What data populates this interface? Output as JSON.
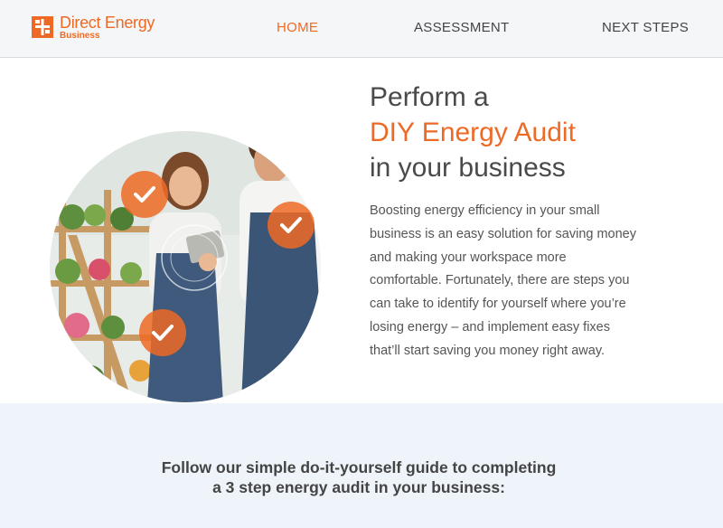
{
  "header": {
    "logo": {
      "name": "Direct Energy",
      "sub": "Business"
    },
    "nav": [
      {
        "label": "HOME",
        "active": true
      },
      {
        "label": "ASSESSMENT",
        "active": false
      },
      {
        "label": "NEXT STEPS",
        "active": false
      }
    ]
  },
  "hero": {
    "title_line1": "Perform a",
    "title_accent": "DIY Energy Audit",
    "title_line3": "in your business",
    "body": "Boosting energy efficiency in your small business is an easy solution for saving money and making your workspace more comfortable. Fortunately, there are steps you can take to identify for yourself where you’re losing energy – and implement easy fixes that’ll start saving you money right away."
  },
  "guide": {
    "line1": "Follow our simple do-it-yourself guide to completing",
    "line2": "a 3 step energy audit in your business:"
  },
  "colors": {
    "accent": "#ee6a24",
    "band": "#eef4f9",
    "header": "#f5f6f8"
  },
  "icons": [
    "direct-energy-logo-icon",
    "check-badge-icon"
  ]
}
